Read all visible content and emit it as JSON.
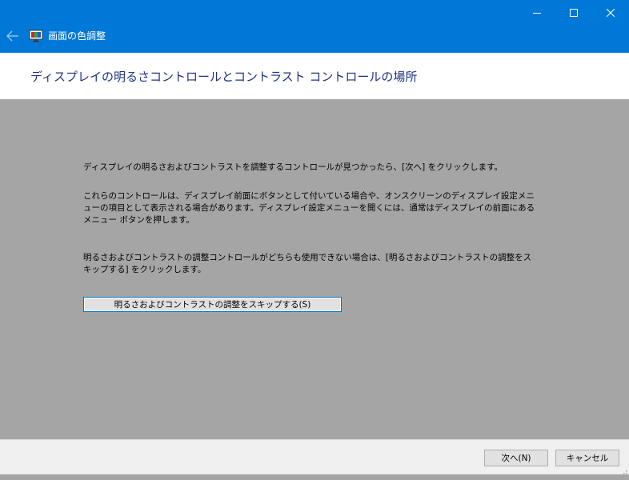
{
  "window": {
    "title": "画面の色調整",
    "controls": {
      "minimize": "minimize-icon",
      "maximize": "maximize-icon",
      "close": "close-icon"
    },
    "back_icon": "back-arrow-icon",
    "app_icon": "display-color-icon"
  },
  "header": {
    "title": "ディスプレイの明るさコントロールとコントラスト コントロールの場所"
  },
  "content": {
    "paragraph1": "ディスプレイの明るさおよびコントラストを調整するコントロールが見つかったら、[次へ] をクリックします。",
    "paragraph2": "これらのコントロールは、ディスプレイ前面にボタンとして付いている場合や、オンスクリーンのディスプレイ設定メニューの項目として表示される場合があります。ディスプレイ設定メニューを開くには、通常はディスプレイの前面にあるメニュー ボタンを押します。",
    "paragraph3": "明るさおよびコントラストの調整コントロールがどちらも使用できない場合は、[明るさおよびコントラストの調整をスキップする] をクリックします。",
    "skip_button": "明るさおよびコントラストの調整をスキップする(S)"
  },
  "footer": {
    "next_button": "次へ(N)",
    "cancel_button": "キャンセル"
  },
  "colors": {
    "titlebar": "#0078d7",
    "content_background": "#a5a5a5",
    "header_background": "#ffffff",
    "heading_text": "#1e3287",
    "footer_background": "#f0f0f0"
  }
}
